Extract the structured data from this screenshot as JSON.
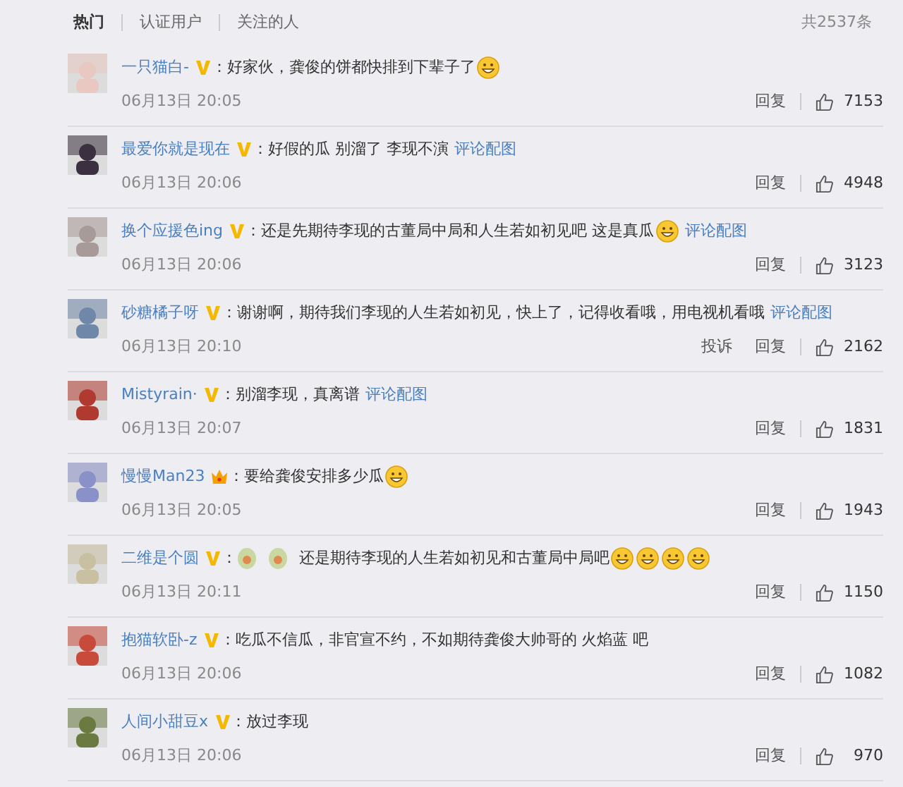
{
  "tabs": [
    {
      "label": "热门",
      "selected": true
    },
    {
      "label": "认证用户",
      "selected": false
    },
    {
      "label": "关注的人",
      "selected": false
    }
  ],
  "total": "共2537条",
  "comments": [
    {
      "user": "一只猫白-",
      "verified": true,
      "member": false,
      "colon": "：",
      "parts": [
        {
          "kind": "text",
          "text": "好家伙，龚俊的饼都快排到下辈子了"
        },
        {
          "kind": "emoji"
        }
      ],
      "time": "06月13日 20:05",
      "actions": [
        "回复"
      ],
      "likes": "7153"
    },
    {
      "user": "最爱你就是现在",
      "verified": true,
      "member": false,
      "colon": "：",
      "parts": [
        {
          "kind": "text",
          "text": "好假的瓜 别溜了 李现不演"
        },
        {
          "kind": "link",
          "text": "评论配图"
        }
      ],
      "time": "06月13日 20:06",
      "actions": [
        "回复"
      ],
      "likes": "4948"
    },
    {
      "user": "换个应援色ing",
      "verified": true,
      "member": false,
      "colon": "：",
      "parts": [
        {
          "kind": "text",
          "text": "还是先期待李现的古董局中局和人生若如初见吧 这是真瓜"
        },
        {
          "kind": "emoji"
        },
        {
          "kind": "link",
          "text": "评论配图"
        }
      ],
      "time": "06月13日 20:06",
      "actions": [
        "回复"
      ],
      "likes": "3123"
    },
    {
      "user": "砂糖橘子呀",
      "verified": true,
      "member": false,
      "colon": "：",
      "parts": [
        {
          "kind": "text",
          "text": "谢谢啊，期待我们李现的人生若如初见，快上了，记得收看哦，用电视机看哦"
        },
        {
          "kind": "link",
          "text": "评论配图"
        }
      ],
      "time": "06月13日 20:10",
      "actions": [
        "投诉",
        "回复"
      ],
      "likes": "2162"
    },
    {
      "user": "Mistyrain·",
      "verified": true,
      "member": false,
      "colon": "：",
      "parts": [
        {
          "kind": "text",
          "text": "别溜李现，真离谱"
        },
        {
          "kind": "link",
          "text": "评论配图"
        }
      ],
      "time": "06月13日 20:07",
      "actions": [
        "回复"
      ],
      "likes": "1831"
    },
    {
      "user": "慢慢Man23",
      "verified": false,
      "member": true,
      "colon": "：",
      "parts": [
        {
          "kind": "text",
          "text": "要给龚俊安排多少瓜"
        },
        {
          "kind": "emoji"
        }
      ],
      "time": "06月13日 20:05",
      "actions": [
        "回复"
      ],
      "likes": "1943"
    },
    {
      "user": "二维是个圆",
      "verified": true,
      "member": false,
      "colon": "：",
      "parts": [
        {
          "kind": "sticker"
        },
        {
          "kind": "sticker"
        },
        {
          "kind": "text",
          "text": "还是期待李现的人生若如初见和古董局中局吧"
        },
        {
          "kind": "emoji"
        },
        {
          "kind": "emoji"
        },
        {
          "kind": "emoji"
        },
        {
          "kind": "emoji"
        }
      ],
      "time": "06月13日 20:11",
      "actions": [
        "回复"
      ],
      "likes": "1150"
    },
    {
      "user": "抱猫软卧-z",
      "verified": true,
      "member": false,
      "colon": "：",
      "parts": [
        {
          "kind": "text",
          "text": "吃瓜不信瓜，非官宣不约，不如期待龚俊大帅哥的 火焰蓝 吧"
        }
      ],
      "time": "06月13日 20:06",
      "actions": [
        "回复"
      ],
      "likes": "1082"
    },
    {
      "user": "人间小甜豆x",
      "verified": true,
      "member": false,
      "colon": "：",
      "parts": [
        {
          "kind": "text",
          "text": "放过李现"
        }
      ],
      "time": "06月13日 20:06",
      "actions": [
        "回复"
      ],
      "likes": "970"
    }
  ]
}
